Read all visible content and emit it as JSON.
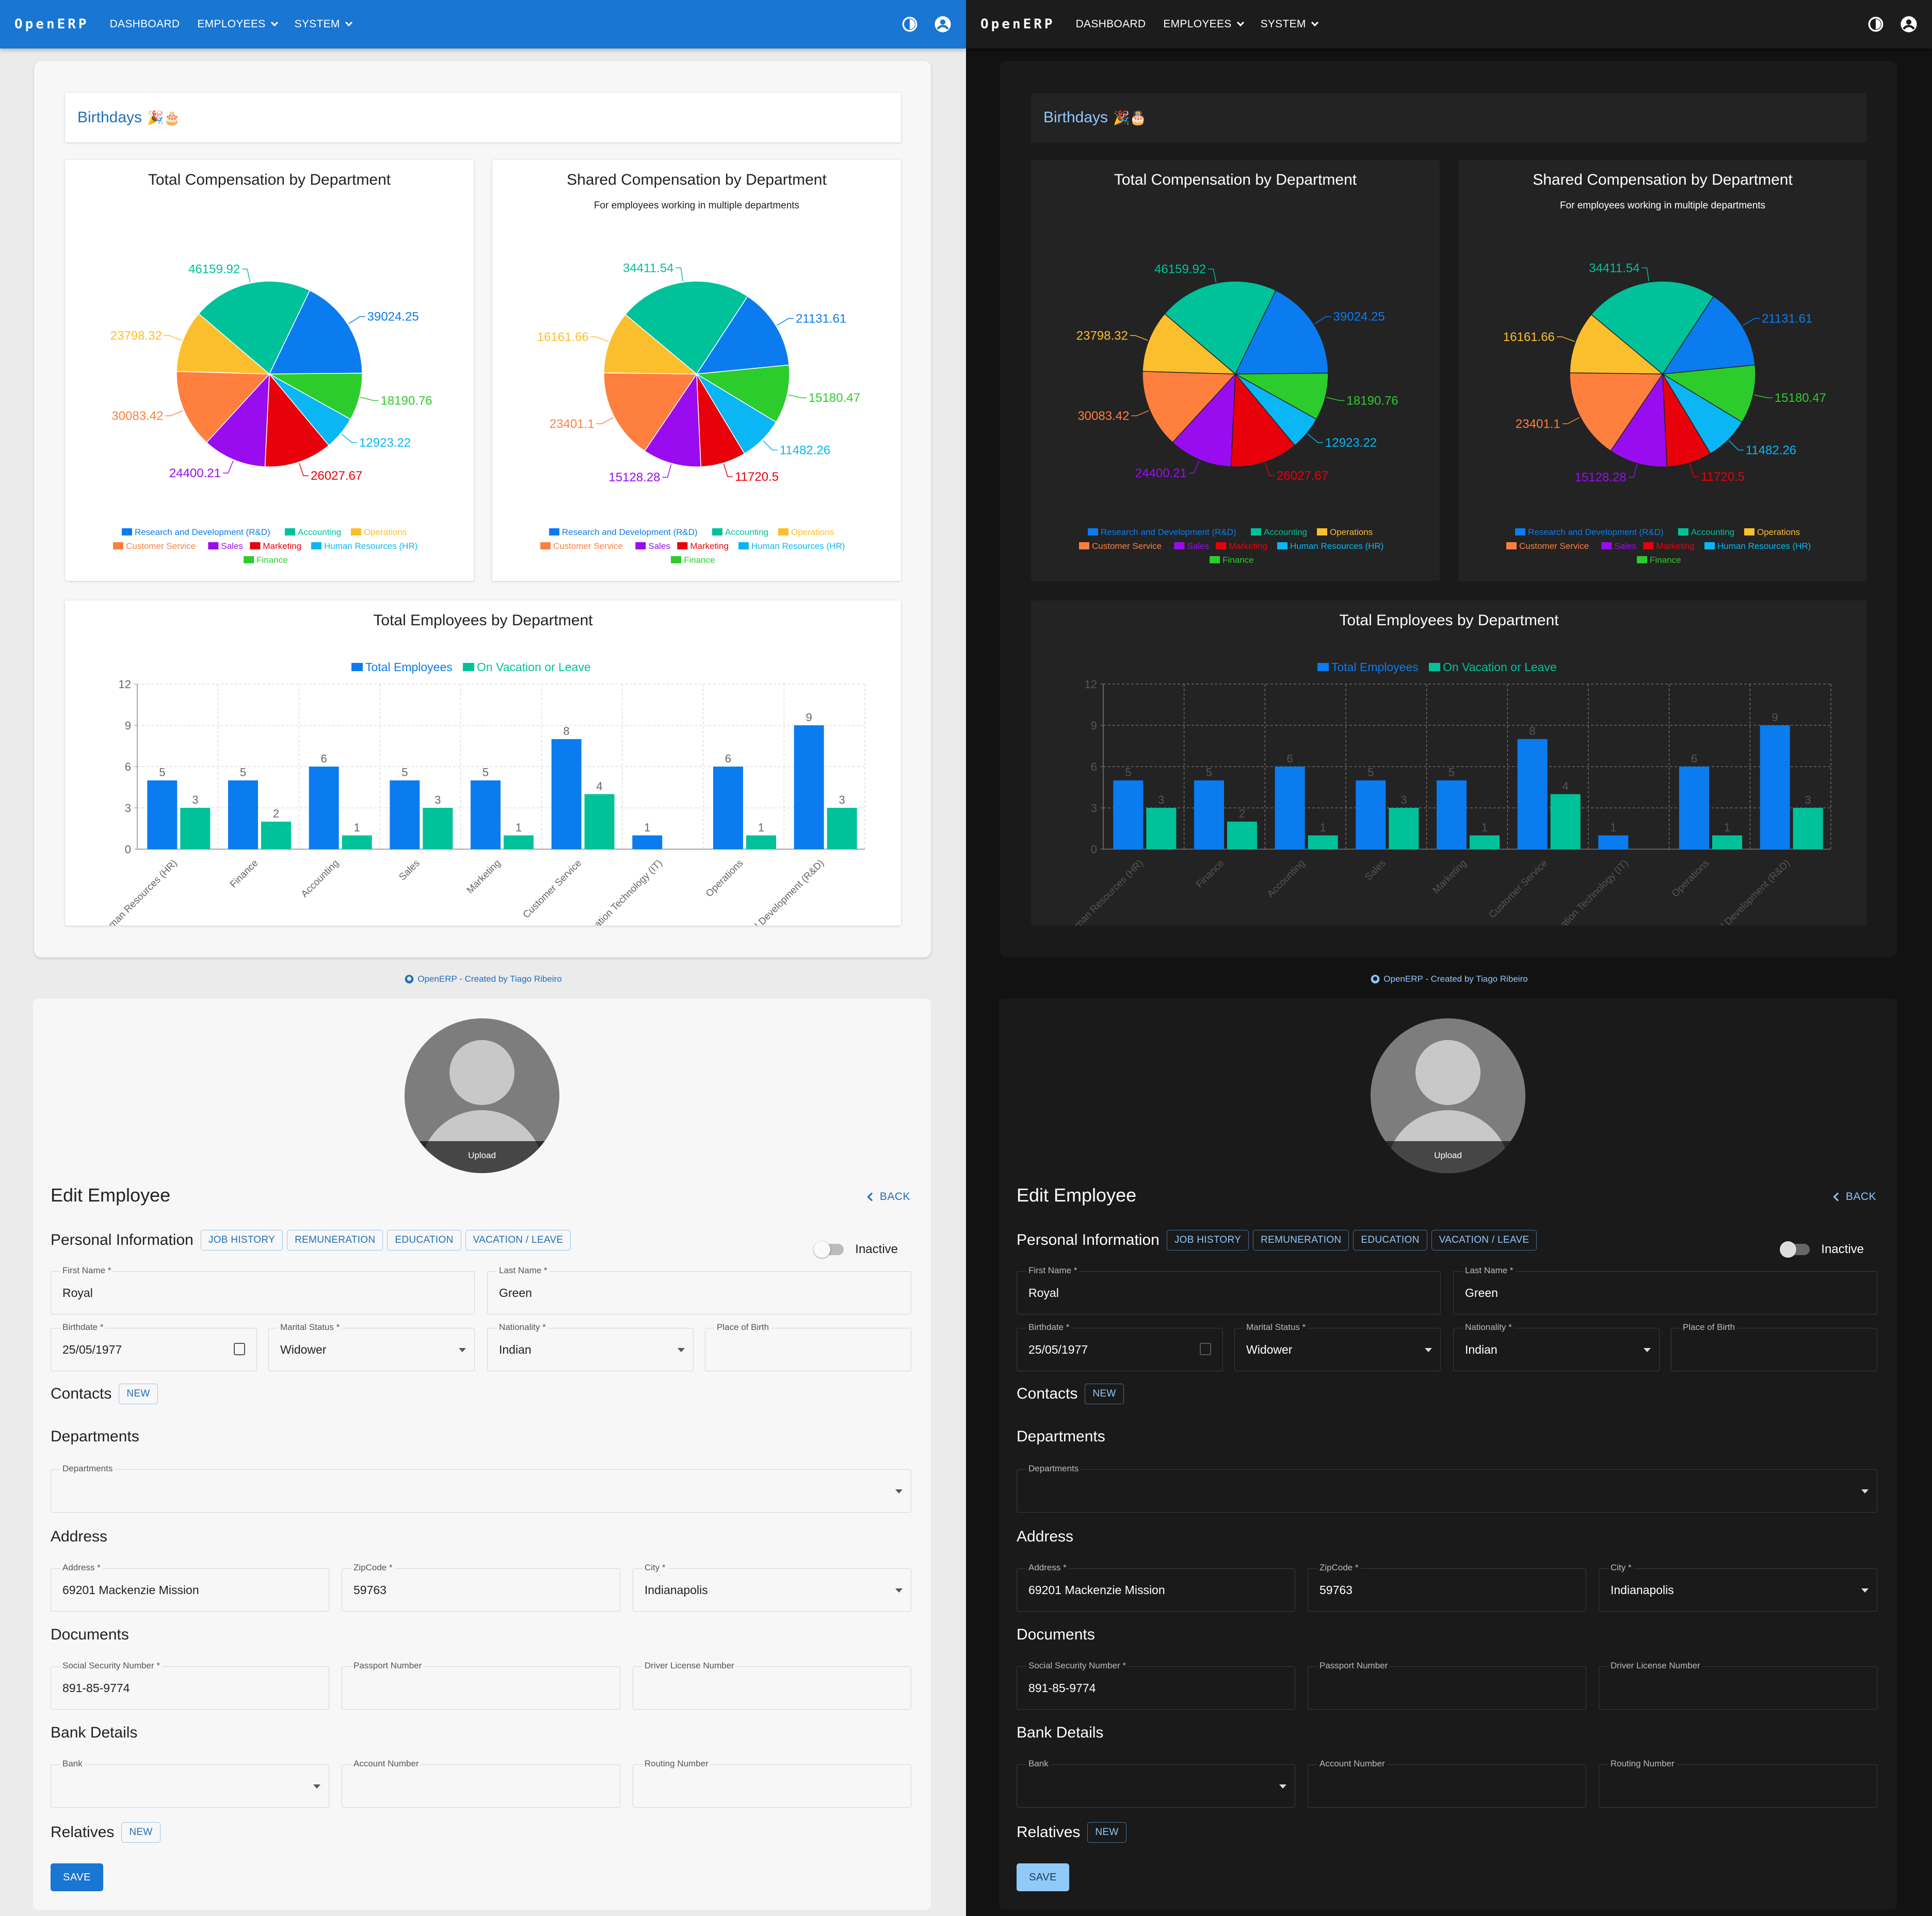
{
  "nav": {
    "brand": "OpenERP",
    "dashboard": "DASHBOARD",
    "employees": "EMPLOYEES",
    "system": "SYSTEM"
  },
  "birthdays": {
    "label": "Birthdays",
    "emoji": "🎉🎂"
  },
  "charts": {
    "total_comp_title": "Total Compensation by Department",
    "shared_comp_title": "Shared Compensation by Department",
    "shared_comp_subtitle": "For employees working in multiple departments",
    "employees_title": "Total Employees by Department"
  },
  "legend": {
    "departments": [
      "Research and Development (R&D)",
      "Accounting",
      "Operations",
      "Customer Service",
      "Sales",
      "Marketing",
      "Human Resources (HR)",
      "Finance"
    ],
    "bar_series": [
      "Total Employees",
      "On Vacation or Leave"
    ]
  },
  "colors": {
    "blue": "#0a7cf0",
    "teal": "#00c29a",
    "yellow": "#fbbf2e",
    "orange": "#ff7f3f",
    "purple": "#9a0cf0",
    "red": "#e8000b",
    "cyan": "#0ab6f4",
    "green": "#2dcc2d",
    "nav_blue": "#1976d2"
  },
  "chart_data": [
    {
      "type": "pie",
      "title": "Total Compensation by Department",
      "slices": [
        {
          "label": "Research and Development (R&D)",
          "value": 39024.25
        },
        {
          "label": "Finance",
          "value": 18190.76
        },
        {
          "label": "Human Resources (HR)",
          "value": 12923.22
        },
        {
          "label": "Marketing",
          "value": 26027.67
        },
        {
          "label": "Sales",
          "value": 24400.21
        },
        {
          "label": "Customer Service",
          "value": 30083.42
        },
        {
          "label": "Operations",
          "value": 23798.32
        },
        {
          "label": "Accounting",
          "value": 46159.92
        }
      ]
    },
    {
      "type": "pie",
      "title": "Shared Compensation by Department",
      "subtitle": "For employees working in multiple departments",
      "slices": [
        {
          "label": "Research and Development (R&D)",
          "value": 21131.61
        },
        {
          "label": "Finance",
          "value": 15180.47
        },
        {
          "label": "Human Resources (HR)",
          "value": 11482.26
        },
        {
          "label": "Marketing",
          "value": 11720.5
        },
        {
          "label": "Sales",
          "value": 15128.28
        },
        {
          "label": "Customer Service",
          "value": 23401.1
        },
        {
          "label": "Operations",
          "value": 16161.66
        },
        {
          "label": "Accounting",
          "value": 34411.54
        }
      ]
    },
    {
      "type": "bar",
      "title": "Total Employees by Department",
      "categories": [
        "Human Resources (HR)",
        "Finance",
        "Accounting",
        "Sales",
        "Marketing",
        "Customer Service",
        "Information Technology (IT)",
        "Operations",
        "Research and Development (R&D)"
      ],
      "series": [
        {
          "name": "Total Employees",
          "values": [
            5,
            5,
            6,
            5,
            5,
            8,
            1,
            6,
            9
          ]
        },
        {
          "name": "On Vacation or Leave",
          "values": [
            3,
            2,
            1,
            3,
            1,
            4,
            0,
            1,
            3
          ]
        }
      ],
      "ylim": [
        0,
        12
      ],
      "yticks": [
        0,
        3,
        6,
        9,
        12
      ],
      "grid": true
    }
  ],
  "footer": "OpenERP - Created by Tiago Ribeiro",
  "form": {
    "upload": "Upload",
    "title": "Edit Employee",
    "back": "BACK",
    "personal_info": "Personal Information",
    "tabs": [
      "JOB HISTORY",
      "REMUNERATION",
      "EDUCATION",
      "VACATION / LEAVE"
    ],
    "inactive": "Inactive",
    "first_name_label": "First Name *",
    "first_name": "Royal",
    "last_name_label": "Last Name *",
    "last_name": "Green",
    "birthdate_label": "Birthdate *",
    "birthdate": "25/05/1977",
    "marital_label": "Marital Status *",
    "marital": "Widower",
    "nationality_label": "Nationality *",
    "nationality": "Indian",
    "pob_label": "Place of Birth",
    "contacts": "Contacts",
    "new": "NEW",
    "departments": "Departments",
    "departments_label": "Departments",
    "address": "Address",
    "address_label": "Address *",
    "address_val": "69201 Mackenzie Mission",
    "zip_label": "ZipCode *",
    "zip": "59763",
    "city_label": "City *",
    "city": "Indianapolis",
    "documents": "Documents",
    "ssn_label": "Social Security Number *",
    "ssn": "891-85-9774",
    "passport_label": "Passport Number",
    "license_label": "Driver License Number",
    "bank_details": "Bank Details",
    "bank_label": "Bank",
    "account_label": "Account Number",
    "routing_label": "Routing Number",
    "relatives": "Relatives",
    "save": "SAVE"
  }
}
